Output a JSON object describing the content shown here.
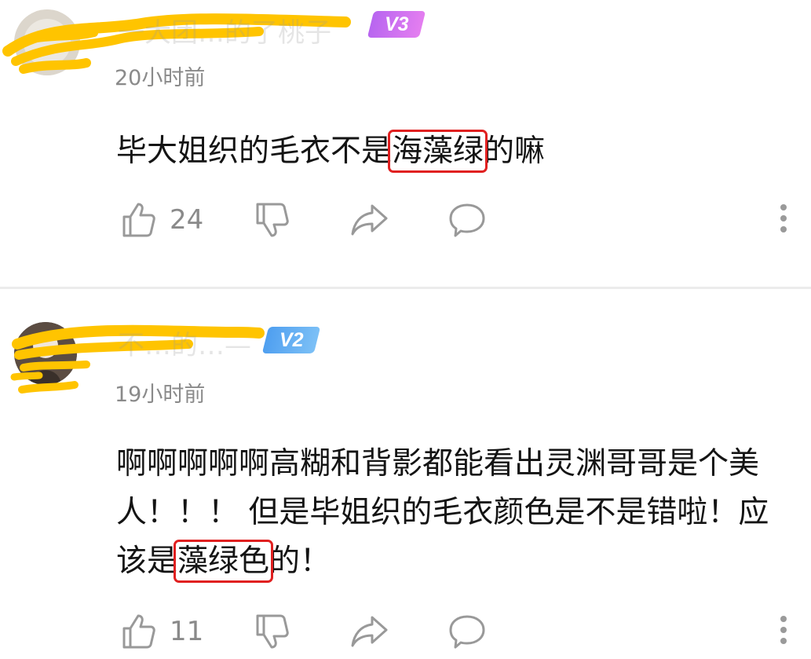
{
  "colors": {
    "highlight_box": "#e02020",
    "v3_badge": "#d46cf0",
    "v2_badge": "#5aa8ef",
    "redaction": "#ffc400",
    "icon_gray": "#999999"
  },
  "comments": [
    {
      "username": "一大团…的了桃子",
      "level": "V3",
      "time": "20小时前",
      "text_before": "毕大姐织的毛衣不是",
      "highlight": "海藻绿",
      "text_after": "的嘛",
      "likes": "24",
      "icons": [
        "thumbs-up-icon",
        "thumbs-down-icon",
        "share-icon",
        "comment-bubble-icon",
        "more-vertical-icon"
      ]
    },
    {
      "username": "不…的…—",
      "level": "V2",
      "time": "19小时前",
      "text_before": "啊啊啊啊啊高糊和背影都能看出灵渊哥哥是个美人！！！ 但是毕姐织的毛衣颜色是不是错啦！应该是",
      "highlight": "藻绿色",
      "text_after": "的！",
      "likes": "11",
      "icons": [
        "thumbs-up-icon",
        "thumbs-down-icon",
        "share-icon",
        "comment-bubble-icon",
        "more-vertical-icon"
      ]
    }
  ]
}
